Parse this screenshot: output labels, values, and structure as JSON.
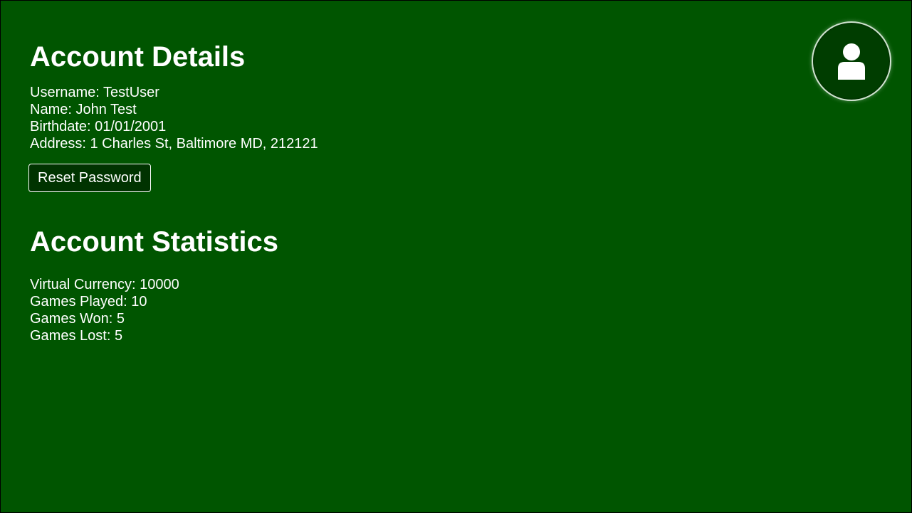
{
  "account_details": {
    "title": "Account Details",
    "username_label": "Username:",
    "username": "TestUser",
    "name_label": "Name:",
    "name": "John Test",
    "birthdate_label": "Birthdate:",
    "birthdate": "01/01/2001",
    "address_label": "Address:",
    "address": "1 Charles St, Baltimore MD, 212121",
    "reset_password_label": "Reset Password"
  },
  "account_statistics": {
    "title": "Account Statistics",
    "currency_label": "Virtual Currency:",
    "currency": "10000",
    "played_label": "Games Played:",
    "played": "10",
    "won_label": "Games Won:",
    "won": "5",
    "lost_label": "Games Lost:",
    "lost": "5"
  },
  "profile": {
    "icon": "user-icon"
  },
  "colors": {
    "background": "#005500",
    "button_background": "#003300",
    "avatar_background": "#003d00",
    "text": "#ffffff"
  }
}
